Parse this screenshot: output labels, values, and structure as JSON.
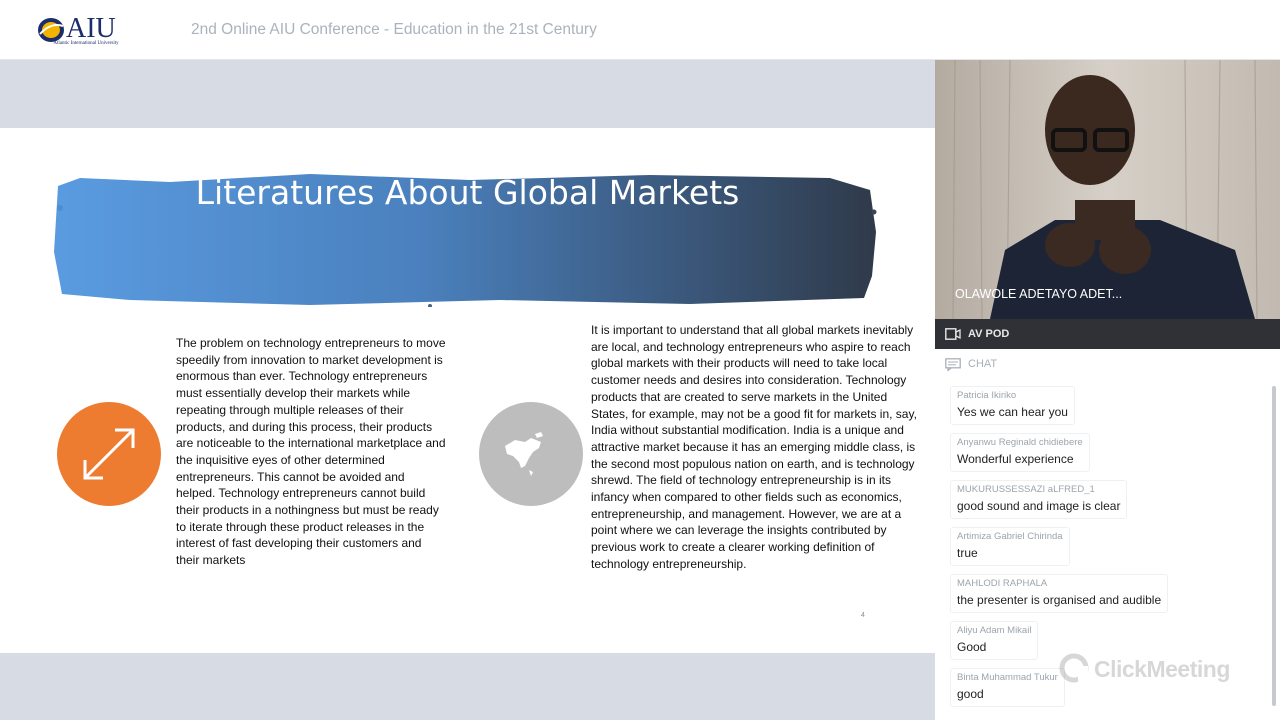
{
  "header": {
    "logo_text": "AIU",
    "logo_subtext": "Atlantic International University",
    "conference_title": "2nd Online AIU Conference - Education in the 21st Century"
  },
  "slide": {
    "title": "Literatures About Global Markets",
    "left_text": "The problem on technology entrepreneurs to move speedily from innovation to market development is enormous than ever. Technology entrepreneurs must essentially develop their markets while repeating through multiple releases of their products, and during this process, their products are noticeable to the international marketplace and the inquisitive eyes of other determined entrepreneurs. This cannot be avoided and helped. Technology entrepreneurs cannot build their products in a nothingness but must be ready to iterate through these product releases in the interest of fast developing their customers and their markets",
    "right_text": "It is important to understand that all global markets inevitably are local, and technology entrepreneurs who aspire to reach global markets with their products will need to take local customer needs and desires into consideration. Technology products that are created to serve markets in the United States, for example, may not be a good fit for markets in, say, India without substantial modification. India is a unique and attractive market because it has an emerging middle class, is the second most populous nation on earth, and is technology shrewd. The field of technology entrepreneurship is in its infancy when compared to other fields such as economics, entrepreneurship, and management.  However, we are at a point where we can leverage the insights contributed by previous work to create a clearer working definition of technology entrepreneurship.",
    "page_number": "4",
    "icons": {
      "left": "expand-arrows-icon",
      "right": "globe-map-icon"
    },
    "colors": {
      "banner": "#4a87c8",
      "orange": "#ee7c30",
      "gray": "#bdbdbd"
    }
  },
  "video": {
    "presenter_name": "OLAWOLE ADETAYO ADET..."
  },
  "av_pod": {
    "label": "AV POD"
  },
  "chat": {
    "label": "CHAT",
    "messages": [
      {
        "author": "Patricia Ikiriko",
        "text": "Yes we can hear you"
      },
      {
        "author": "Anyanwu Reginald chidiebere",
        "text": "Wonderful experience"
      },
      {
        "author": "MUKURUSSESSAZI aLFRED_1",
        "text": "good sound and image is clear"
      },
      {
        "author": "Artimiza Gabriel Chirinda",
        "text": "true"
      },
      {
        "author": "MAHLODI RAPHALA",
        "text": "the presenter is organised and audible"
      },
      {
        "author": "Aliyu Adam Mikail",
        "text": "Good"
      },
      {
        "author": "Binta Muhammad Tukur",
        "text": "good"
      }
    ]
  },
  "watermark": {
    "text": "ClickMeeting"
  }
}
